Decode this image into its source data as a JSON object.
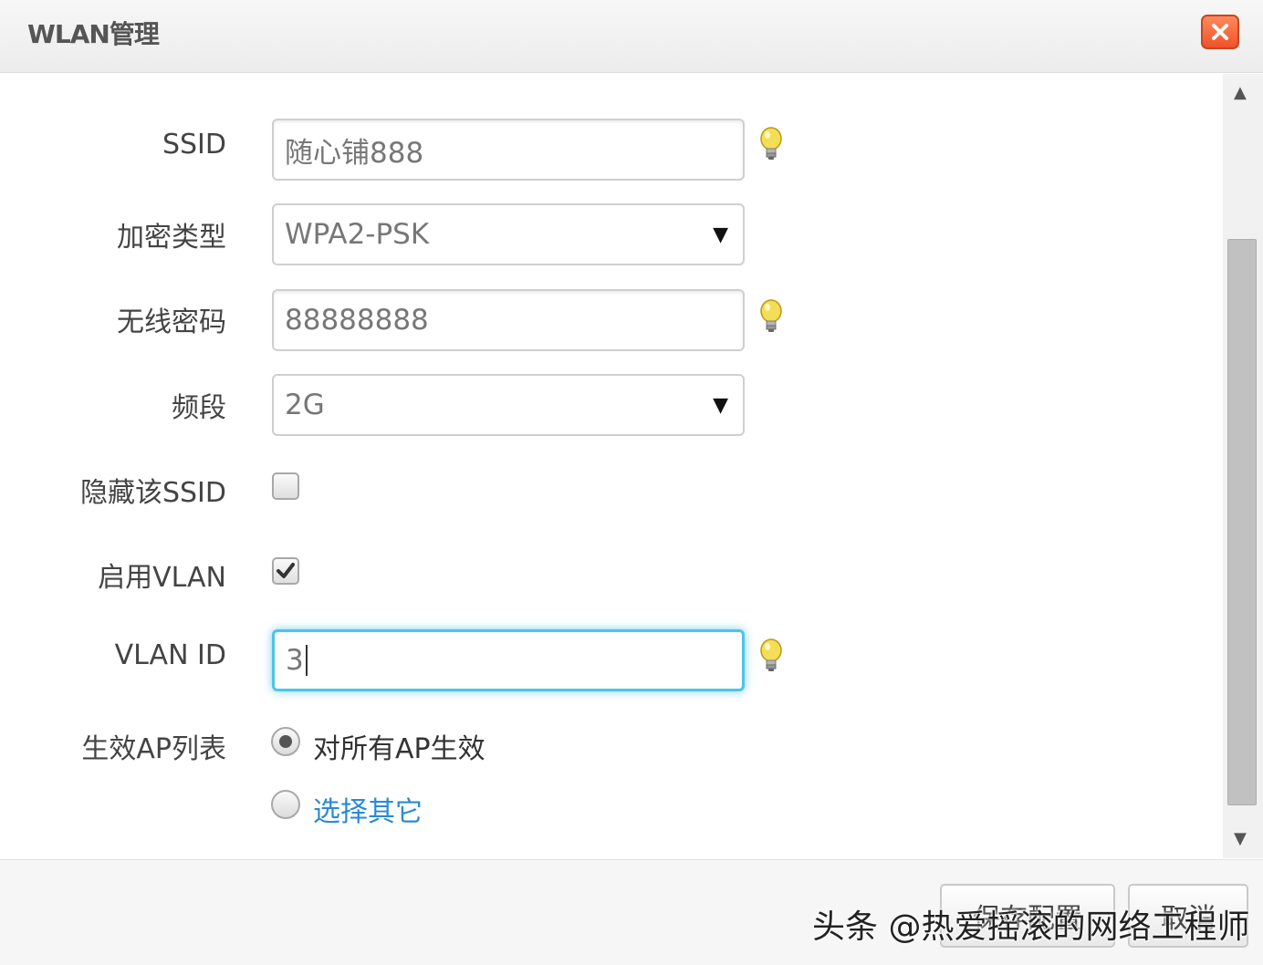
{
  "window": {
    "title": "WLAN管理"
  },
  "form": {
    "ssid": {
      "label": "SSID",
      "value": "随心铺888"
    },
    "encryption": {
      "label": "加密类型",
      "value": "WPA2-PSK"
    },
    "password": {
      "label": "无线密码",
      "value": "88888888"
    },
    "band": {
      "label": "频段",
      "value": "2G"
    },
    "hide_ssid": {
      "label": "隐藏该SSID",
      "checked": false
    },
    "enable_vlan": {
      "label": "启用VLAN",
      "checked": true
    },
    "vlan_id": {
      "label": "VLAN ID",
      "value": "3"
    },
    "ap_list": {
      "label": "生效AP列表",
      "options": [
        {
          "label": "对所有AP生效",
          "selected": true
        },
        {
          "label": "选择其它",
          "selected": false
        }
      ]
    }
  },
  "footer": {
    "save_label": "保存配置",
    "cancel_label": "取消",
    "watermark": "头条 @热爱摇滚的网络工程师"
  },
  "icons": {
    "close": "close-x-icon",
    "tip": "lightbulb-icon",
    "dropdown": "caret-down-icon",
    "check": "checkmark-icon",
    "scroll_up": "arrow-up-icon",
    "scroll_down": "arrow-down-icon"
  },
  "colors": {
    "close_button": "#f0522a",
    "focus_border": "#4fc3e8",
    "link_text": "#2a8ad4",
    "tip_bulb": "#f2d64b"
  }
}
